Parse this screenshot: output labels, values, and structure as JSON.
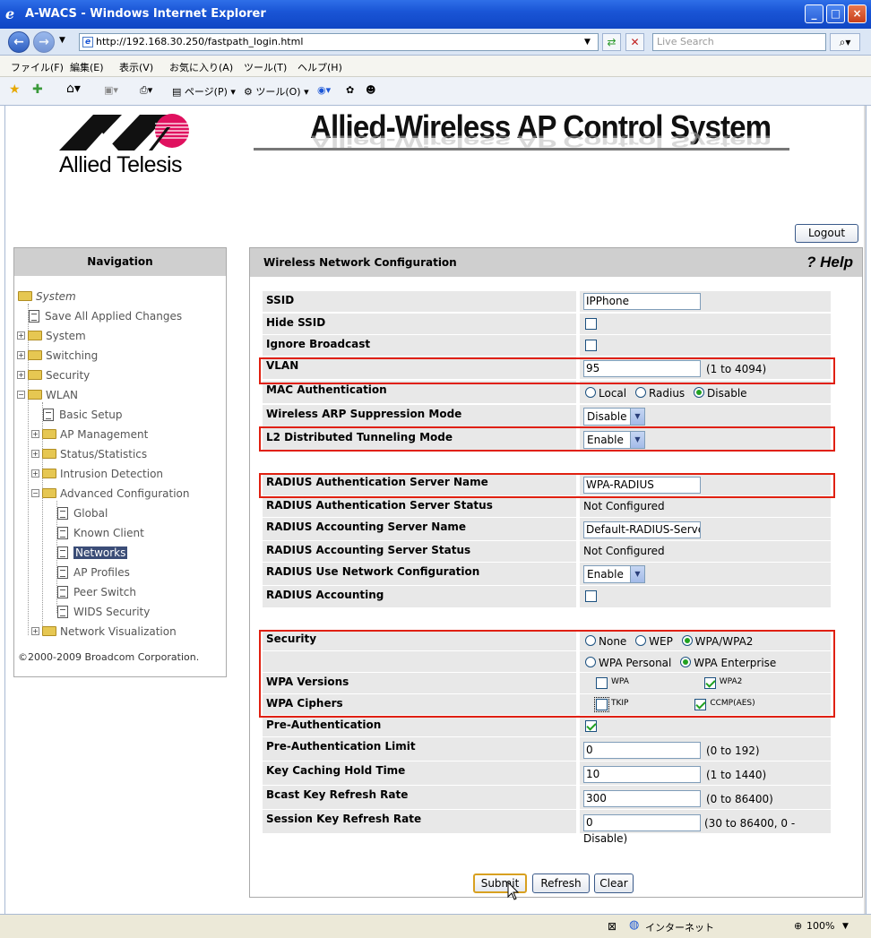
{
  "window": {
    "title": "A-WACS - Windows Internet Explorer",
    "min": "_",
    "max": "□",
    "close": "×"
  },
  "addressbar": {
    "url": "http://192.168.30.250/fastpath_login.html",
    "search_placeholder": "Live Search"
  },
  "menubar": [
    "ファイル(F)",
    "編集(E)",
    "表示(V)",
    "お気に入り(A)",
    "ツール(T)",
    "ヘルプ(H)"
  ],
  "toolbar": {
    "page": "ページ(P)",
    "tools": "ツール(O)"
  },
  "header": {
    "logo_text": "Allied Telesis",
    "banner": "Allied-Wireless AP Control System",
    "logout": "Logout"
  },
  "nav": {
    "title": "Navigation",
    "root": "System",
    "items": [
      {
        "label": "Save All Applied Changes",
        "type": "doc",
        "level": 1
      },
      {
        "label": "System",
        "type": "folder",
        "level": 1
      },
      {
        "label": "Switching",
        "type": "folder",
        "level": 1
      },
      {
        "label": "Security",
        "type": "folder",
        "level": 1
      },
      {
        "label": "WLAN",
        "type": "folder-open",
        "level": 1
      },
      {
        "label": "Basic Setup",
        "type": "doc",
        "level": 2
      },
      {
        "label": "AP Management",
        "type": "folder",
        "level": 2
      },
      {
        "label": "Status/Statistics",
        "type": "folder",
        "level": 2
      },
      {
        "label": "Intrusion Detection",
        "type": "folder",
        "level": 2
      },
      {
        "label": "Advanced Configuration",
        "type": "folder-open",
        "level": 2
      },
      {
        "label": "Global",
        "type": "doc",
        "level": 3
      },
      {
        "label": "Known Client",
        "type": "doc",
        "level": 3
      },
      {
        "label": "Networks",
        "type": "doc",
        "level": 3,
        "selected": true
      },
      {
        "label": "AP Profiles",
        "type": "doc",
        "level": 3
      },
      {
        "label": "Peer Switch",
        "type": "doc",
        "level": 3
      },
      {
        "label": "WIDS Security",
        "type": "doc",
        "level": 3
      },
      {
        "label": "Network Visualization",
        "type": "folder",
        "level": 2
      }
    ],
    "copyright": "©2000-2009 Broadcom Corporation."
  },
  "content": {
    "title": "Wireless Network Configuration",
    "help": "? Help",
    "fields": {
      "ssid": {
        "label": "SSID",
        "value": "IPPhone"
      },
      "hide_ssid": {
        "label": "Hide SSID"
      },
      "ignore_broadcast": {
        "label": "Ignore Broadcast"
      },
      "vlan": {
        "label": "VLAN",
        "value": "95",
        "hint": "(1 to 4094)"
      },
      "mac_auth": {
        "label": "MAC Authentication",
        "options": [
          "Local",
          "Radius",
          "Disable"
        ],
        "selected": "Disable"
      },
      "arp_suppression": {
        "label": "Wireless ARP Suppression Mode",
        "value": "Disable"
      },
      "l2_tunneling": {
        "label": "L2 Distributed Tunneling Mode",
        "value": "Enable"
      },
      "radius_auth_name": {
        "label": "RADIUS Authentication Server Name",
        "value": "WPA-RADIUS"
      },
      "radius_auth_status": {
        "label": "RADIUS Authentication Server Status",
        "value": "Not Configured"
      },
      "radius_acct_name": {
        "label": "RADIUS Accounting Server Name",
        "value": "Default-RADIUS-Server"
      },
      "radius_acct_status": {
        "label": "RADIUS Accounting Server Status",
        "value": "Not Configured"
      },
      "radius_use_net": {
        "label": "RADIUS Use Network Configuration",
        "value": "Enable"
      },
      "radius_accounting": {
        "label": "RADIUS Accounting"
      },
      "security": {
        "label": "Security",
        "options": [
          "None",
          "WEP",
          "WPA/WPA2"
        ],
        "selected": "WPA/WPA2",
        "mode_options": [
          "WPA Personal",
          "WPA Enterprise"
        ],
        "mode_selected": "WPA Enterprise"
      },
      "wpa_versions": {
        "label": "WPA Versions",
        "opt1": "WPA",
        "opt2": "WPA2"
      },
      "wpa_ciphers": {
        "label": "WPA Ciphers",
        "opt1": "TKIP",
        "opt2": "CCMP(AES)"
      },
      "pre_auth": {
        "label": "Pre-Authentication"
      },
      "pre_auth_limit": {
        "label": "Pre-Authentication Limit",
        "value": "0",
        "hint": "(0 to 192)"
      },
      "key_caching": {
        "label": "Key Caching Hold Time",
        "value": "10",
        "hint": "(1 to 1440)"
      },
      "bcast_key": {
        "label": "Bcast Key Refresh Rate",
        "value": "300",
        "hint": "(0 to 86400)"
      },
      "session_key": {
        "label": "Session Key Refresh Rate",
        "value": "0",
        "hint": "(30 to 86400, 0 - Disable)"
      }
    },
    "buttons": {
      "submit": "Submit",
      "refresh": "Refresh",
      "clear": "Clear"
    }
  },
  "statusbar": {
    "zone": "インターネット",
    "zoom": "100%"
  }
}
